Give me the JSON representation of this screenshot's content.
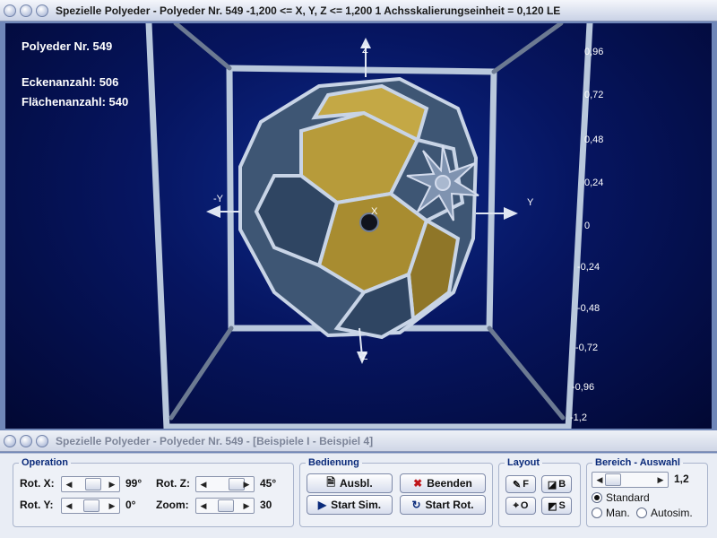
{
  "window_top": {
    "title": "Spezielle Polyeder - Polyeder Nr. 549   -1,200 <= X, Y, Z <= 1,200    1 Achsskalierungseinheit = 0,120 LE"
  },
  "window_bottom": {
    "title": "Spezielle Polyeder - Polyeder Nr. 549 - [Beispiele I - Beispiel 4]"
  },
  "scene": {
    "polyeder_label": "Polyeder Nr. 549",
    "ecken_label": "Eckenanzahl: 506",
    "flaechen_label": "Flächenanzahl: 540",
    "axis_labels": {
      "z_top": "Z",
      "z_bottom": "-Z",
      "y_right": "Y",
      "y_left": "-Y",
      "x_center": "X"
    },
    "right_ticks": [
      "0,96",
      "0,72",
      "0,48",
      "0,24",
      "0",
      "-0,24",
      "-0,48",
      "-0,72",
      "-0,96",
      "-1,2"
    ],
    "colors": {
      "frame": "#b9c8dc",
      "face_gold": "#b79b3a",
      "face_blue": "#3e5674"
    }
  },
  "panel": {
    "operation": {
      "legend": "Operation",
      "rot_x_label": "Rot. X:",
      "rot_x_value": "99°",
      "rot_y_label": "Rot. Y:",
      "rot_y_value": "0°",
      "rot_z_label": "Rot. Z:",
      "rot_z_value": "45°",
      "zoom_label": "Zoom:",
      "zoom_value": "30"
    },
    "bedienung": {
      "legend": "Bedienung",
      "ausbl": "Ausbl.",
      "beenden": "Beenden",
      "start_sim": "Start Sim.",
      "start_rot": "Start Rot."
    },
    "layout": {
      "legend": "Layout",
      "f": "F",
      "b": "B",
      "o": "O",
      "s": "S"
    },
    "bereich": {
      "legend": "Bereich - Auswahl",
      "value": "1,2",
      "standard": "Standard",
      "man": "Man.",
      "autosim": "Autosim.",
      "selected": "standard"
    }
  }
}
